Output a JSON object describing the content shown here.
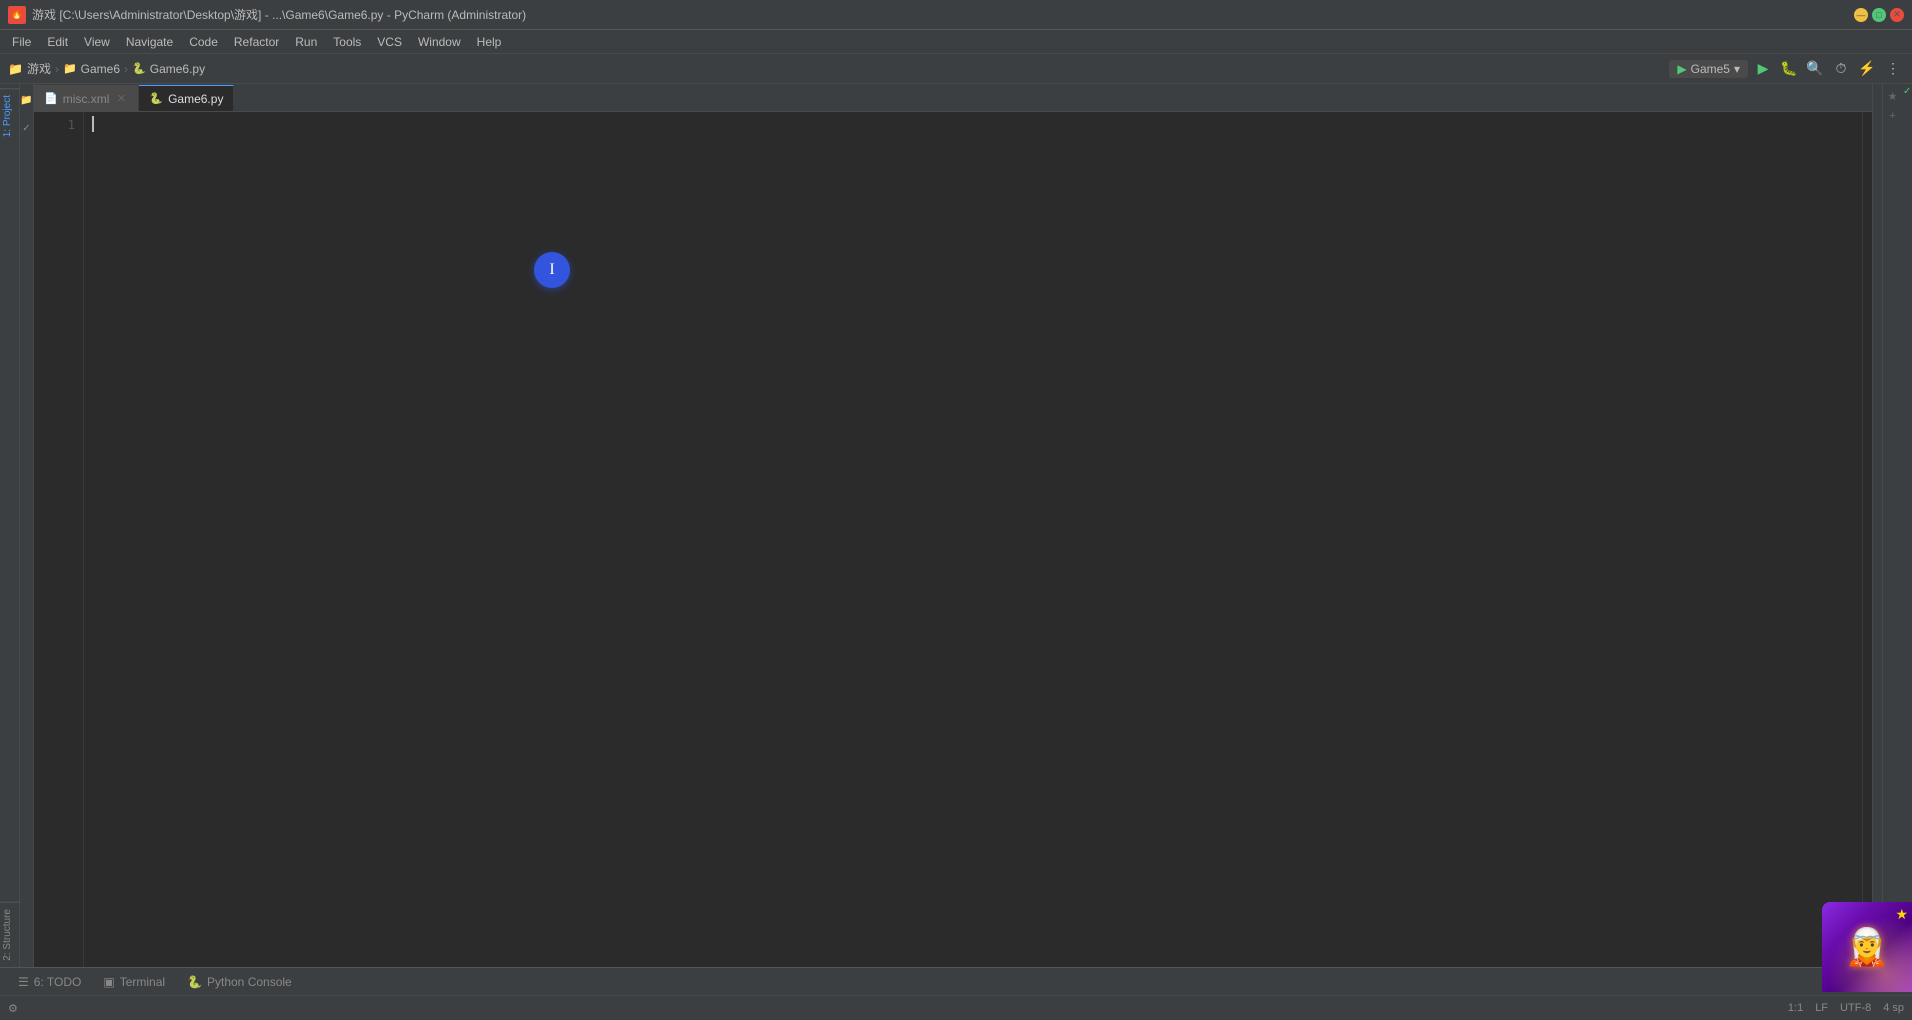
{
  "titlebar": {
    "app_icon": "🔥",
    "title": "游戏 [C:\\Users\\Administrator\\Desktop\\游戏] - ...\\Game6\\Game6.py - PyCharm (Administrator)",
    "minimize_label": "—",
    "maximize_label": "□",
    "close_label": "✕"
  },
  "menubar": {
    "items": [
      "File",
      "Edit",
      "View",
      "Navigate",
      "Code",
      "Refactor",
      "Run",
      "Tools",
      "VCS",
      "Window",
      "Help"
    ]
  },
  "toolbar": {
    "breadcrumb_home": "游戏",
    "breadcrumb_sep1": "›",
    "breadcrumb_game6": "Game6",
    "breadcrumb_sep2": "›",
    "breadcrumb_file": "Game6.py",
    "run_config": "Game5",
    "run_btn": "▶",
    "debug_btn": "🐛"
  },
  "tabs": [
    {
      "label": "misc.xml",
      "icon": "📄",
      "active": false
    },
    {
      "label": "Game6.py",
      "icon": "🐍",
      "active": true
    }
  ],
  "editor": {
    "placeholder": ""
  },
  "vertical_panel_tabs": [
    {
      "id": "project",
      "label": "1: Project",
      "active": true
    },
    {
      "id": "structure",
      "label": "2: Structure",
      "active": false
    }
  ],
  "favorites": {
    "star_icon": "★",
    "add_icon": "+"
  },
  "bottom_tabs": [
    {
      "label": "6: TODO",
      "icon": "☰",
      "active": false
    },
    {
      "label": "Terminal",
      "icon": "▣",
      "active": false
    },
    {
      "label": "Python Console",
      "icon": "🐍",
      "active": false
    }
  ],
  "statusbar": {
    "position": "1:1",
    "encoding": "UTF-8",
    "line_separator": "LF",
    "indent": "4 sp"
  },
  "colors": {
    "accent": "#4a9eff",
    "bg_dark": "#2b2b2b",
    "bg_medium": "#3c3f41",
    "run_green": "#50c878",
    "circle_blue": "#3355dd"
  }
}
